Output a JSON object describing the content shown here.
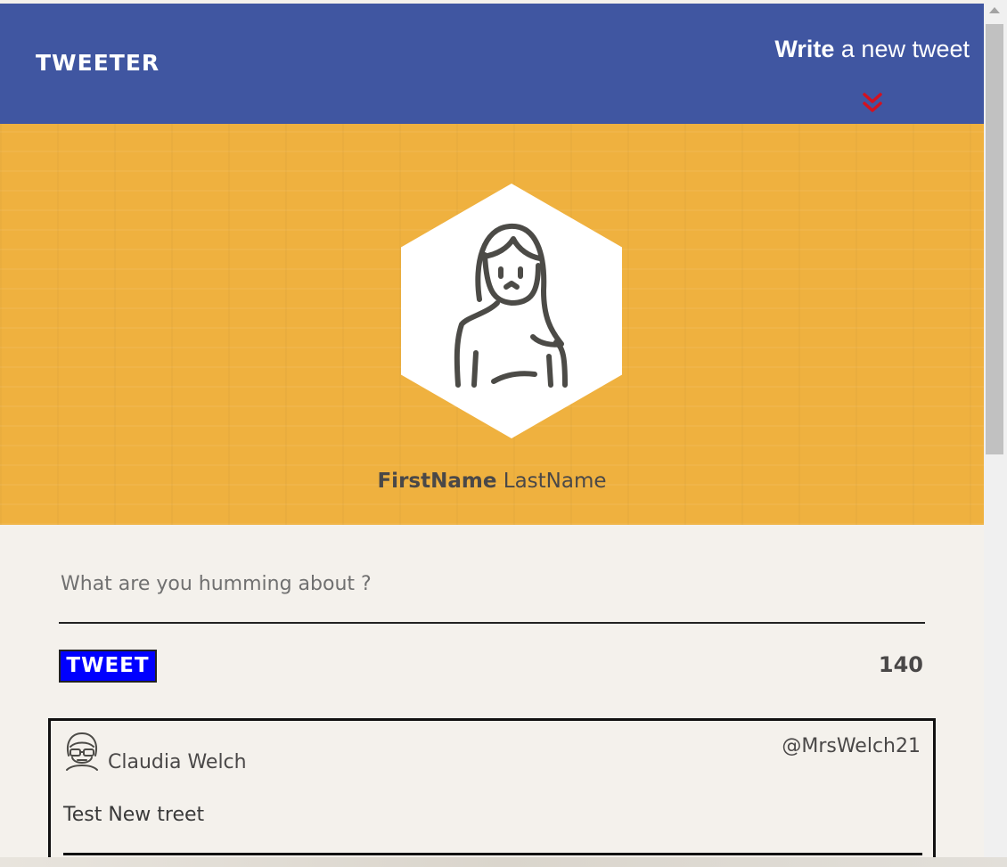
{
  "header": {
    "logo": "TWEETER",
    "write_bold": "Write",
    "write_rest": " a new tweet",
    "chevron_icon": "double-chevron-down-icon",
    "chevron_color": "#d3111f",
    "background": "#4056a1"
  },
  "profile": {
    "avatar_icon": "woman-avatar-icon",
    "first_name": "FirstName",
    "last_name": "LastName",
    "banner_color": "#efb13f"
  },
  "composer": {
    "placeholder": "What are you humming about ?",
    "button_label": "TWEET",
    "char_count": "140"
  },
  "tweets": [
    {
      "avatar_icon": "man-with-glasses-avatar-icon",
      "name": "Claudia Welch",
      "handle": "@MrsWelch21",
      "text": "Test New treet"
    }
  ]
}
